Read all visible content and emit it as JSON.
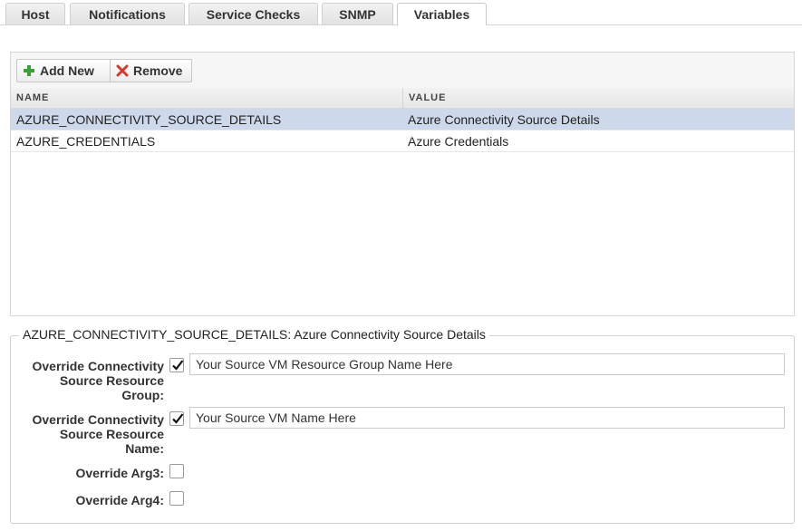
{
  "tabs": [
    {
      "label": "Host",
      "active": false
    },
    {
      "label": "Notifications",
      "active": false
    },
    {
      "label": "Service Checks",
      "active": false
    },
    {
      "label": "SNMP",
      "active": false
    },
    {
      "label": "Variables",
      "active": true
    }
  ],
  "toolbar": {
    "add_label": "Add New",
    "remove_label": "Remove",
    "add_icon": "plus-icon",
    "remove_icon": "x-icon"
  },
  "table": {
    "columns": [
      "NAME",
      "VALUE"
    ],
    "rows": [
      {
        "name": "AZURE_CONNECTIVITY_SOURCE_DETAILS",
        "value": "Azure Connectivity Source Details",
        "selected": true
      },
      {
        "name": "AZURE_CREDENTIALS",
        "value": "Azure Credentials",
        "selected": false
      }
    ]
  },
  "details": {
    "legend": "AZURE_CONNECTIVITY_SOURCE_DETAILS: Azure Connectivity Source Details",
    "fields": [
      {
        "label_lines": [
          "Override Connectivity",
          "Source Resource",
          "Group:"
        ],
        "checked": true,
        "value": "Your Source VM Resource Group Name Here"
      },
      {
        "label_lines": [
          "Override Connectivity",
          "Source Resource",
          "Name:"
        ],
        "checked": true,
        "value": "Your Source VM Name Here"
      },
      {
        "label_lines": [
          "Override Arg3:"
        ],
        "checked": false
      },
      {
        "label_lines": [
          "Override Arg4:"
        ],
        "checked": false
      }
    ]
  },
  "colors": {
    "selected_row": "#cdd9ea",
    "plus_icon": "#3aa335",
    "remove_icon": "#d13b2e"
  }
}
